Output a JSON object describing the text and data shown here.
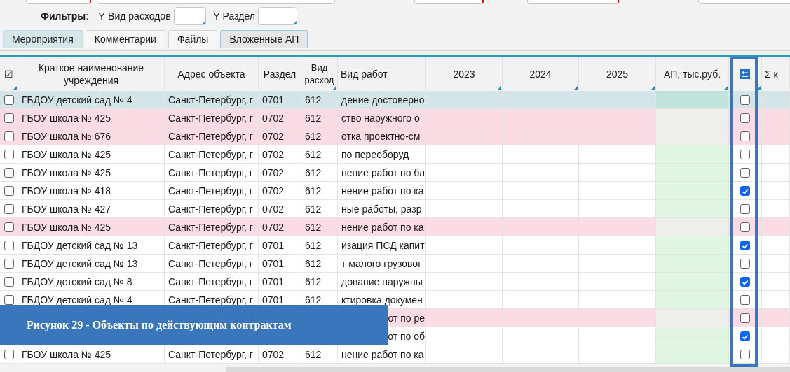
{
  "filters": {
    "label": "Фильтры",
    "colon": ":",
    "items": [
      {
        "label": "Вид расходов"
      },
      {
        "label": "Раздел"
      }
    ]
  },
  "tabs": [
    {
      "label": "Мероприятия",
      "selected": true
    },
    {
      "label": "Комментарии",
      "selected": false
    },
    {
      "label": "Файлы",
      "selected": false
    },
    {
      "label": "Вложенные АП",
      "selected": false
    }
  ],
  "table": {
    "columns": [
      {
        "label": "☑",
        "marker": true
      },
      {
        "label": "Краткое наименование учреждения",
        "marker": false
      },
      {
        "label": "Адрес объекта",
        "marker": false
      },
      {
        "label": "Раздел",
        "marker": false
      },
      {
        "label": "Вид расход",
        "marker": true
      },
      {
        "label": "Вид работ",
        "marker": false
      },
      {
        "label": "2023",
        "marker": true
      },
      {
        "label": "2024",
        "marker": true
      },
      {
        "label": "2025",
        "marker": true
      },
      {
        "label": "АП, тыс.руб.",
        "marker": true
      },
      {
        "kind": "icon",
        "marker": true
      },
      {
        "label": "Σ к",
        "marker": false
      }
    ],
    "rows": [
      {
        "selected": true,
        "flagged": false,
        "marked": false,
        "name": "ГБДОУ детский сад № 4",
        "address": "Санкт-Петербург, г",
        "section": "0701",
        "expense": "612",
        "work": "дение достоверно",
        "checked": false
      },
      {
        "selected": false,
        "flagged": true,
        "marked": false,
        "name": "ГБОУ школа № 425",
        "address": "Санкт-Петербург, г",
        "section": "0702",
        "expense": "612",
        "work": "ство наружного о",
        "checked": false
      },
      {
        "selected": false,
        "flagged": true,
        "marked": false,
        "name": "ГБОУ школа № 676",
        "address": "Санкт-Петербург, г",
        "section": "0702",
        "expense": "612",
        "work": "отка проектно-см",
        "checked": false
      },
      {
        "selected": false,
        "flagged": false,
        "marked": false,
        "name": "ГБОУ школа № 425",
        "address": "Санкт-Петербург, г",
        "section": "0702",
        "expense": "612",
        "work": "по переоборуд",
        "checked": false
      },
      {
        "selected": false,
        "flagged": false,
        "marked": false,
        "name": "ГБОУ школа № 425",
        "address": "Санкт-Петербург, г",
        "section": "0702",
        "expense": "612",
        "work": "нение работ по бл",
        "checked": false
      },
      {
        "selected": false,
        "flagged": false,
        "marked": false,
        "name": "ГБОУ школа № 418",
        "address": "Санкт-Петербург, г",
        "section": "0702",
        "expense": "612",
        "work": "нение работ по ка",
        "checked": true
      },
      {
        "selected": false,
        "flagged": false,
        "marked": false,
        "name": "ГБОУ школа № 427",
        "address": "Санкт-Петербург, г",
        "section": "0702",
        "expense": "612",
        "work": "ные работы, разр",
        "checked": false
      },
      {
        "selected": false,
        "flagged": true,
        "marked": false,
        "name": "ГБОУ школа № 425",
        "address": "Санкт-Петербург, г",
        "section": "0702",
        "expense": "612",
        "work": "нение работ по ка",
        "checked": false
      },
      {
        "selected": false,
        "flagged": false,
        "marked": false,
        "name": "ГБДОУ детский сад № 13",
        "address": "Санкт-Петербург, г",
        "section": "0701",
        "expense": "612",
        "work": "изация ПСД капит",
        "checked": true
      },
      {
        "selected": false,
        "flagged": false,
        "marked": false,
        "name": "ГБДОУ детский сад № 13",
        "address": "Санкт-Петербург, г",
        "section": "0701",
        "expense": "612",
        "work": "т малого грузовог",
        "checked": false
      },
      {
        "selected": false,
        "flagged": false,
        "marked": false,
        "name": "ГБДОУ детский сад № 8",
        "address": "Санкт-Петербург, г",
        "section": "0701",
        "expense": "612",
        "work": "дование наружны",
        "checked": true
      },
      {
        "selected": false,
        "flagged": false,
        "marked": false,
        "name": "ГБДОУ детский сад № 4",
        "address": "Санкт-Петербург, г",
        "section": "0701",
        "expense": "612",
        "work": "ктировка докумен",
        "checked": false
      },
      {
        "selected": false,
        "flagged": true,
        "work": "от по ре",
        "checked": false
      },
      {
        "selected": false,
        "flagged": false,
        "work": "от по об",
        "checked": true
      },
      {
        "selected": false,
        "flagged": false,
        "marked": false,
        "name": "ГБОУ школа № 425",
        "address": "Санкт-Петербург, г",
        "section": "0702",
        "expense": "612",
        "work": "нение работ по ка",
        "checked": false
      }
    ]
  },
  "caption": "Рисунок 29 - Объекты по действующим контрактам"
}
